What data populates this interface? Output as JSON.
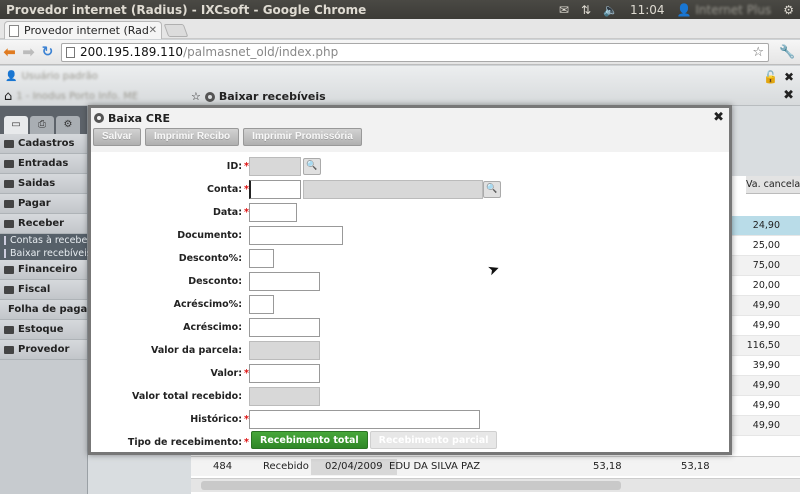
{
  "os": {
    "window_title": "Provedor internet (Radius) - IXCsoft - Google Chrome",
    "clock": "11:04",
    "user": "Internet Plus"
  },
  "browser": {
    "tab_title": "Provedor internet (Radius",
    "url_host": "200.195.189.110",
    "url_path": "/palmasnet_old/index.php"
  },
  "app": {
    "user_label": "Usuário padrão",
    "company_label": "1 - Inodus Porto Info. ME",
    "window_title": "Baixar recebíveis"
  },
  "sidebar": {
    "items": [
      "Cadastros",
      "Entradas",
      "Saidas",
      "Pagar",
      "Receber"
    ],
    "sub_items": [
      "Contas à receber",
      "Baixar recebíveis"
    ],
    "items_after": [
      "Financeiro",
      "Fiscal",
      "Folha de pagamento",
      "Estoque",
      "Provedor"
    ]
  },
  "grid": {
    "column_header": "Va. cancelado",
    "values": [
      "24,90",
      "25,00",
      "75,00",
      "20,00",
      "49,90",
      "49,90",
      "116,50",
      "39,90",
      "49,90",
      "49,90",
      "49,90"
    ],
    "bottom_row": {
      "id": "484",
      "status": "Recebido",
      "date": "02/04/2009",
      "name": "EDU DA SILVA PAZ",
      "value1": "53,18",
      "value2": "53,18"
    }
  },
  "modal": {
    "title": "Baixa CRE",
    "toolbar": [
      "Salvar",
      "Imprimir Recibo",
      "Imprimir Promissória"
    ],
    "fields": {
      "id": "ID:",
      "conta": "Conta:",
      "data": "Data:",
      "documento": "Documento:",
      "desconto_pct": "Desconto%:",
      "desconto": "Desconto:",
      "acrescimo_pct": "Acréscimo%:",
      "acrescimo": "Acréscimo:",
      "valor_parcela": "Valor da parcela:",
      "valor": "Valor:",
      "valor_total": "Valor total recebido:",
      "historico": "Histórico:",
      "tipo": "Tipo de recebimento:"
    },
    "tipo_options": [
      "Recebimento total",
      "Recebimento parcial"
    ],
    "required_mark": "*"
  }
}
